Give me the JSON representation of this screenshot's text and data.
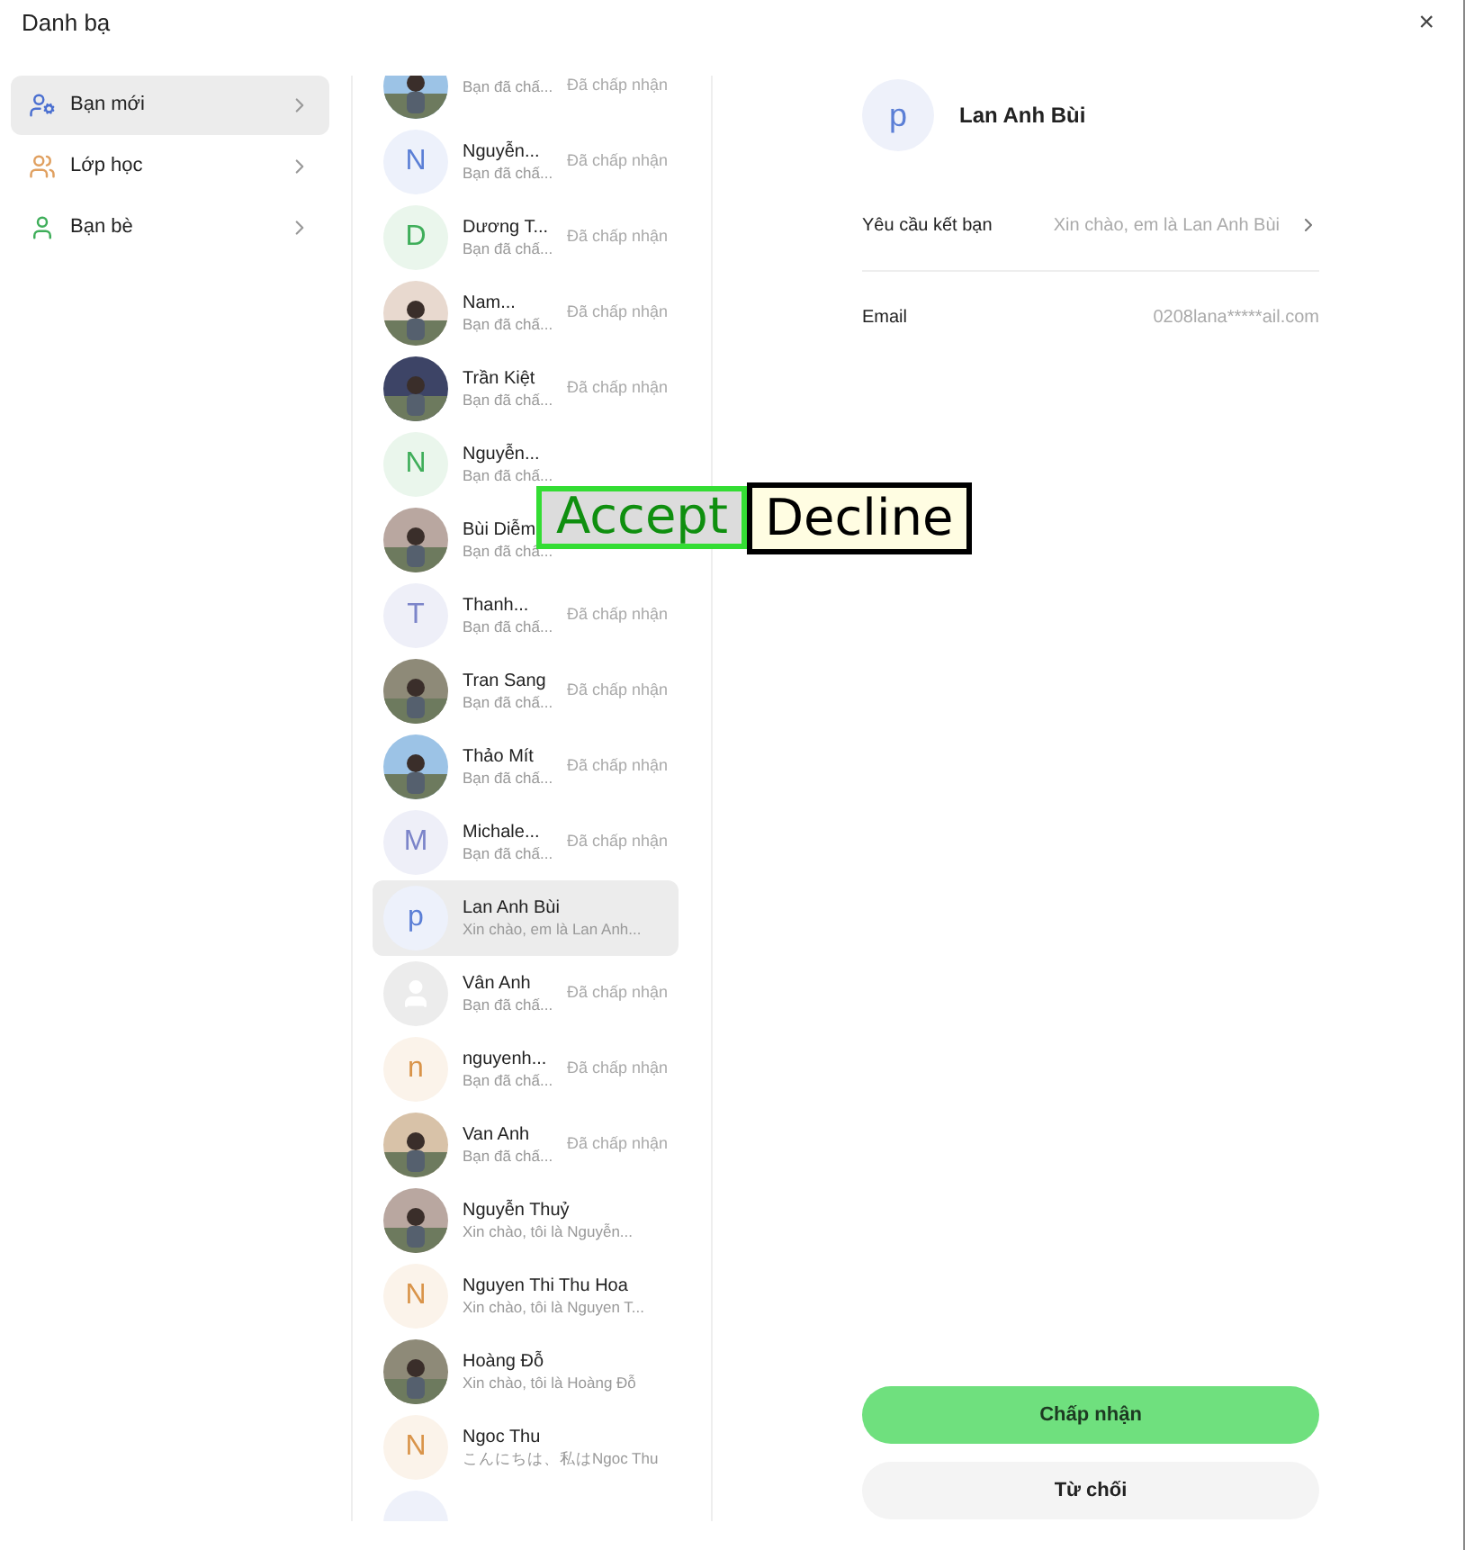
{
  "window": {
    "title": "Danh bạ",
    "close": "×"
  },
  "sidebar": {
    "items": [
      {
        "label": "Bạn mới",
        "selected": true,
        "kind": "new"
      },
      {
        "label": "Lớp học",
        "selected": false,
        "kind": "class"
      },
      {
        "label": "Bạn bè",
        "selected": false,
        "kind": "friends"
      }
    ]
  },
  "requests": [
    {
      "sub": "Bạn đã chấ...",
      "status": "Đã chấp nhận",
      "selected": false
    },
    {
      "kind": "letter",
      "letter": "N",
      "color": "#5b7fd6",
      "name": "Nguyễn...",
      "sub": "Bạn đã chấ...",
      "status": "Đã chấp nhận",
      "selected": false
    },
    {
      "kind": "letter",
      "letter": "D",
      "color": "#3fae5a",
      "name": "Dương T...",
      "sub": "Bạn đã chấ...",
      "status": "Đã chấp nhận",
      "selected": false
    },
    {
      "name": "Nam...",
      "sub": "Bạn đã chấ...",
      "status": "Đã chấp nhận",
      "selected": false
    },
    {
      "name": "Trần Kiệt",
      "sub": "Bạn đã chấ...",
      "status": "Đã chấp nhận",
      "selected": false
    },
    {
      "kind": "letter",
      "letter": "N",
      "color": "#3fae5a",
      "name": "Nguyễn...",
      "sub": "Bạn đã chấ...",
      "selected": false
    },
    {
      "name": "Bùi Diễm",
      "sub": "Bạn đã chấ...",
      "selected": false
    },
    {
      "kind": "letter",
      "letter": "T",
      "color": "#7b84c9",
      "name": "Thanh...",
      "sub": "Bạn đã chấ...",
      "status": "Đã chấp nhận",
      "selected": false
    },
    {
      "name": "Tran Sang",
      "sub": "Bạn đã chấ...",
      "status": "Đã chấp nhận",
      "selected": false
    },
    {
      "name": "Thảo Mít",
      "sub": "Bạn đã chấ...",
      "status": "Đã chấp nhận",
      "selected": false
    },
    {
      "kind": "letter",
      "letter": "M",
      "color": "#7b84c9",
      "name": "Michale...",
      "sub": "Bạn đã chấ...",
      "status": "Đã chấp nhận",
      "selected": false
    },
    {
      "kind": "letter",
      "letter": "p",
      "color": "#5b7fd6",
      "name": "Lan Anh Bùi",
      "sub": "Xin chào, em là Lan Anh...",
      "selected": true
    },
    {
      "kind": "default",
      "name": "Vân Anh",
      "sub": "Bạn đã chấ...",
      "status": "Đã chấp nhận",
      "selected": false
    },
    {
      "kind": "letter",
      "letter": "n",
      "color": "#d9944a",
      "name": "nguyenh...",
      "sub": "Bạn đã chấ...",
      "status": "Đã chấp nhận",
      "selected": false
    },
    {
      "name": "Van Anh",
      "sub": "Bạn đã chấ...",
      "status": "Đã chấp nhận",
      "selected": false
    },
    {
      "name": "Nguyễn Thuỷ",
      "sub": "Xin chào, tôi là Nguyễn...",
      "selected": false
    },
    {
      "kind": "letter",
      "letter": "N",
      "color": "#d9944a",
      "name": "Nguyen Thi Thu Hoa",
      "sub": "Xin chào, tôi là Nguyen T...",
      "selected": false
    },
    {
      "name": "Hoàng Đỗ",
      "sub": "Xin chào, tôi là Hoàng Đỗ",
      "selected": false
    },
    {
      "kind": "letter",
      "letter": "N",
      "color": "#d9944a",
      "name": "Ngoc Thu",
      "sub": "こんにちは、私はNgoc Thu",
      "selected": false
    },
    {
      "kind": "blank",
      "selected": false
    }
  ],
  "detail": {
    "avatar_letter": "p",
    "name": "Lan Anh Bùi",
    "fields": [
      {
        "label": "Yêu cầu kết bạn",
        "value": "Xin chào, em là Lan Anh Bùi",
        "chevron": true
      },
      {
        "label": "Email",
        "value": "0208lana*****ail.com",
        "chevron": false
      }
    ],
    "accept": "Chấp nhận",
    "decline": "Từ chối"
  },
  "overlays": [
    {
      "kind": "accept",
      "label": "Accept"
    },
    {
      "kind": "decline",
      "label": "Decline"
    }
  ]
}
